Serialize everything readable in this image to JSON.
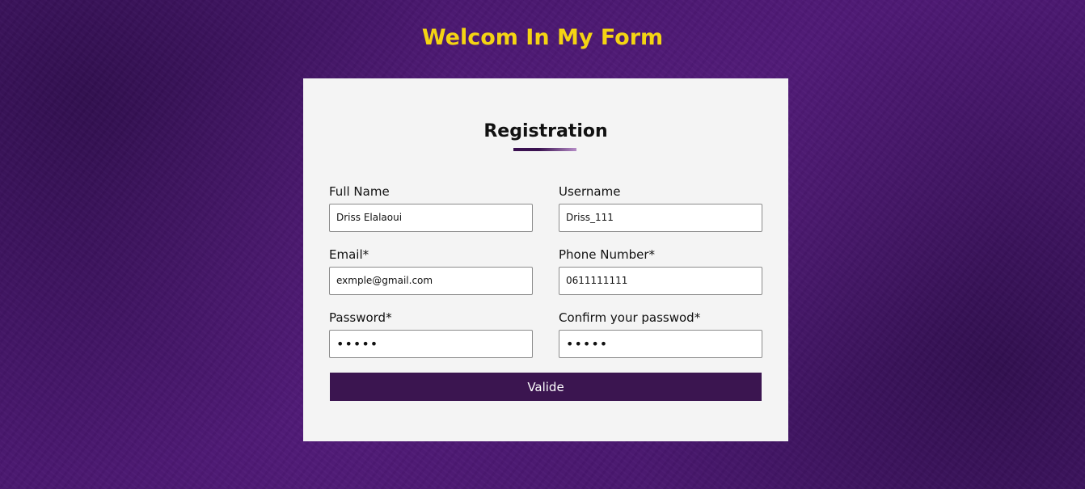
{
  "header": {
    "title": "Welcom In My Form"
  },
  "form": {
    "title": "Registration",
    "fields": {
      "full_name": {
        "label": "Full Name",
        "value": "Driss Elalaoui"
      },
      "username": {
        "label": "Username",
        "value": "Driss_111"
      },
      "email": {
        "label": "Email*",
        "value": "exmple@gmail.com"
      },
      "phone": {
        "label": "Phone Number*",
        "value": "0611111111"
      },
      "password": {
        "label": "Password*",
        "value": "•••••"
      },
      "confirm_password": {
        "label": "Confirm your passwod*",
        "value": "•••••"
      }
    },
    "submit_label": "Valide"
  },
  "colors": {
    "background": "#4a1770",
    "title": "#f4d413",
    "card": "#f4f4f4",
    "button": "#3b1550"
  }
}
